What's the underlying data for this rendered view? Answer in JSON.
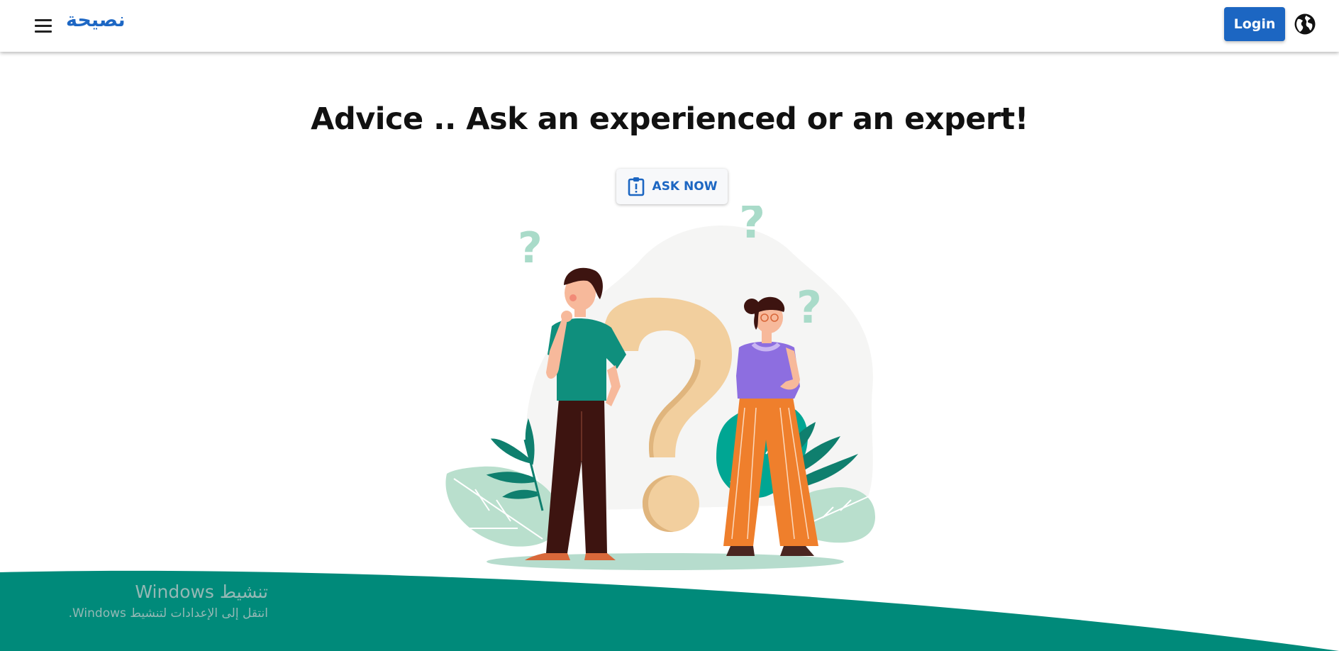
{
  "header": {
    "brand": "نصيحة",
    "menu_icon": "menu-icon",
    "login_label": "Login",
    "language_icon": "globe-icon"
  },
  "hero": {
    "headline": "Advice .. Ask an experienced or an expert!",
    "ask_button_label": "ASK NOW",
    "ask_button_icon": "clipboard-alert-icon"
  },
  "illustration": {
    "icon": "question-people-illustration",
    "question_mark_glyph": "?"
  },
  "footer": {
    "color": "#008a7a"
  },
  "watermark": {
    "title": "تنشيط Windows",
    "subtitle": "انتقل إلى الإعدادات لتنشيط Windows."
  },
  "colors": {
    "primary": "#1c66c2",
    "teal": "#008a7a",
    "mint": "#a9dbc9",
    "question_beige": "#f2cf9e",
    "orange_pants": "#ef7f2c",
    "purple_top": "#8d6ee0"
  }
}
